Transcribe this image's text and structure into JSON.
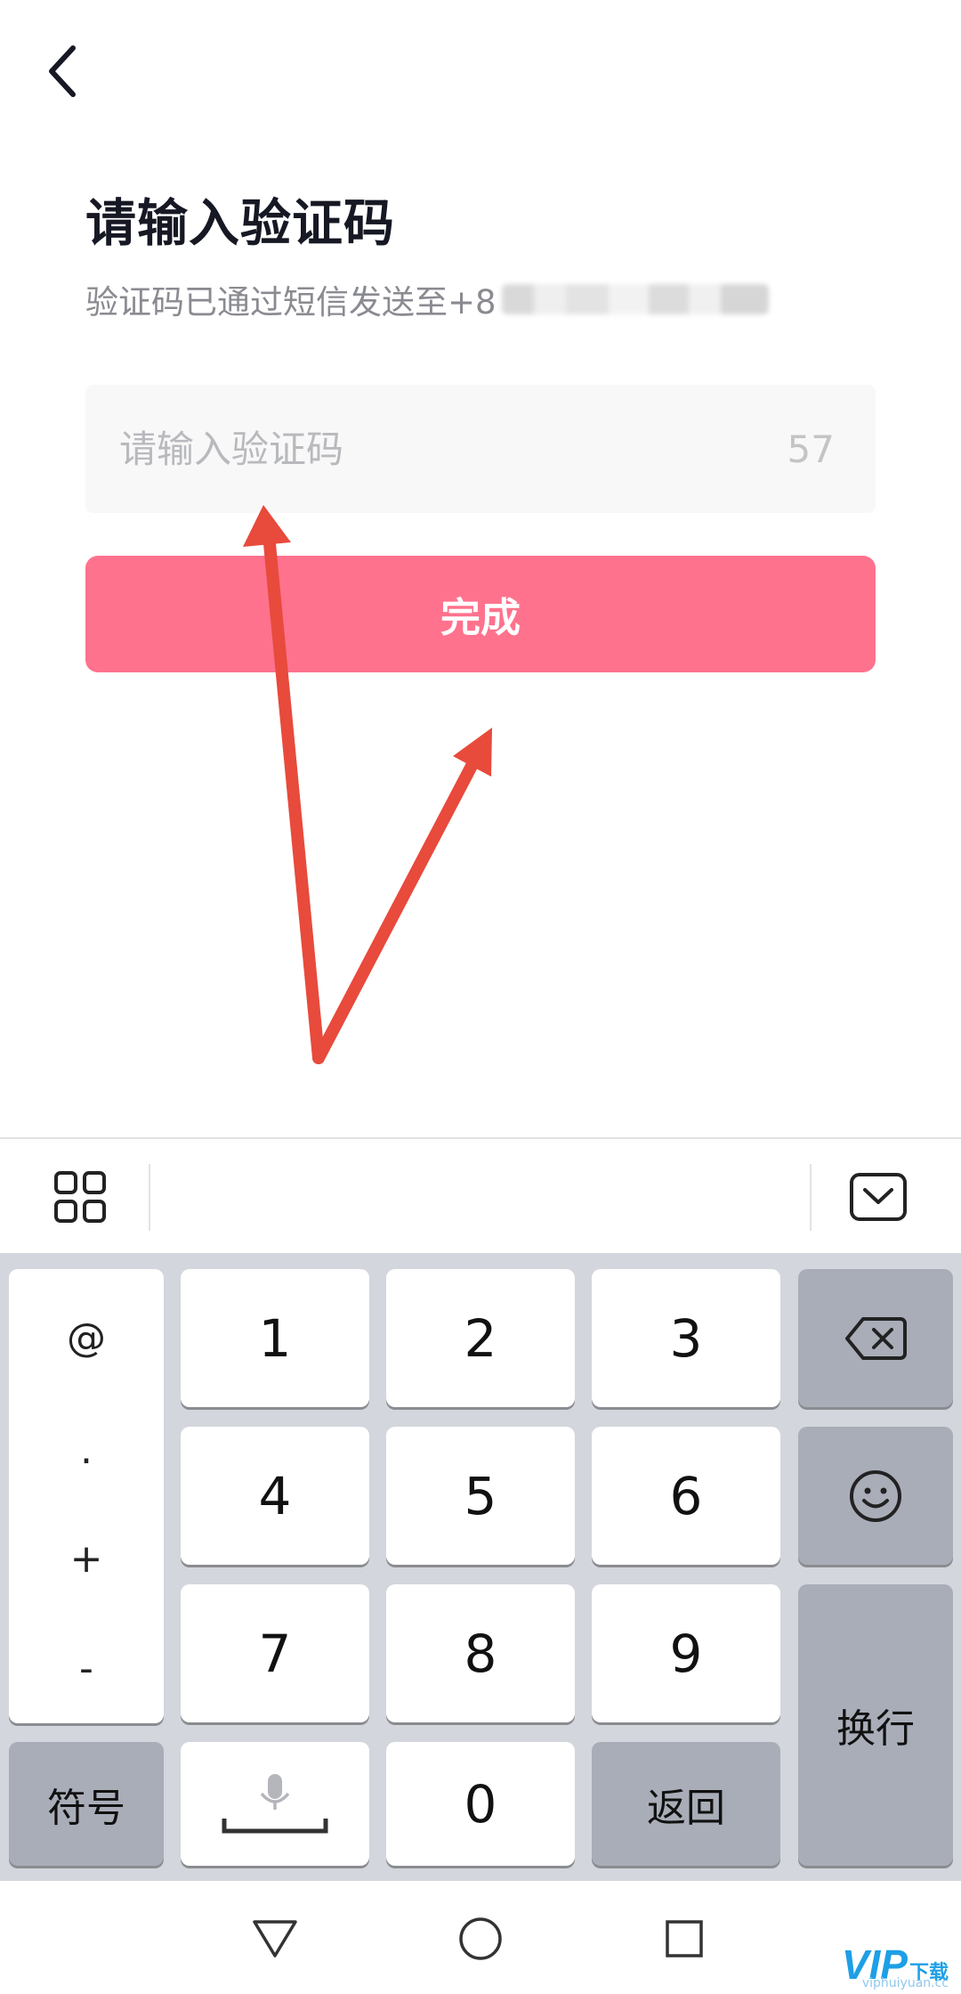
{
  "header": {
    "back_icon": "chevron-left-icon"
  },
  "page": {
    "title": "请输入验证码",
    "subtitle": "验证码已通过短信发送至+8"
  },
  "code_field": {
    "placeholder": "请输入验证码",
    "value": "",
    "countdown": "57"
  },
  "done_button": {
    "label": "完成"
  },
  "colors": {
    "accent": "#ff728d",
    "annotation_arrow": "#e84a3c",
    "keyboard_bg": "#d3d6dc",
    "function_key": "#a9adb8"
  },
  "keyboard": {
    "toolbar": {
      "left_icon": "grid-icon",
      "right_icon": "keyboard-hide-icon"
    },
    "symbols": [
      "@",
      ".",
      "+",
      "-"
    ],
    "digits": [
      "1",
      "2",
      "3",
      "4",
      "5",
      "6",
      "7",
      "8",
      "9",
      "0"
    ],
    "symbol_key": "符号",
    "mic_icon": "microphone-icon",
    "back_key": "返回",
    "enter_key": "换行",
    "backspace_icon": "backspace-icon",
    "emoji_icon": "smiley-icon"
  },
  "navbar": {
    "back_icon": "triangle-back-icon",
    "home_icon": "circle-home-icon",
    "recents_icon": "square-recents-icon"
  },
  "watermark": {
    "logo": "VIP",
    "label": "下载",
    "url": "viphuiyuan.cc"
  }
}
